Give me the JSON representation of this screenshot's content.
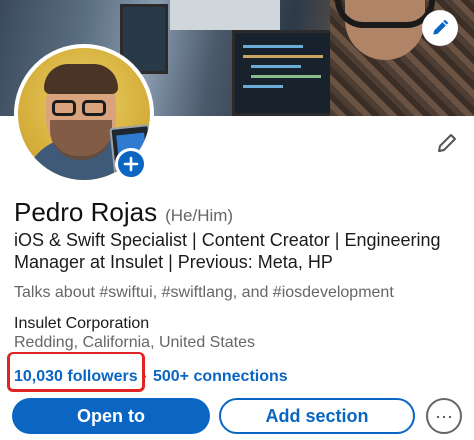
{
  "profile": {
    "name": "Pedro Rojas",
    "pronouns": "(He/Him)",
    "headline": "iOS & Swift Specialist | Content Creator | Engineering Manager at Insulet | Previous: Meta, HP",
    "talks_about": "Talks about #swiftui, #swiftlang, and #iosdevelopment",
    "company": "Insulet Corporation",
    "location": "Redding, California, United States",
    "followers": "10,030 followers",
    "separator": "·",
    "connections": "500+ connections"
  },
  "actions": {
    "open_to": "Open to",
    "add_section": "Add section",
    "more": "···"
  },
  "icons": {
    "cover_edit": "pencil-icon",
    "avatar_add": "plus-icon",
    "profile_edit": "pencil-icon"
  },
  "colors": {
    "brand": "#0a66c2",
    "annotation": "#e02424"
  }
}
